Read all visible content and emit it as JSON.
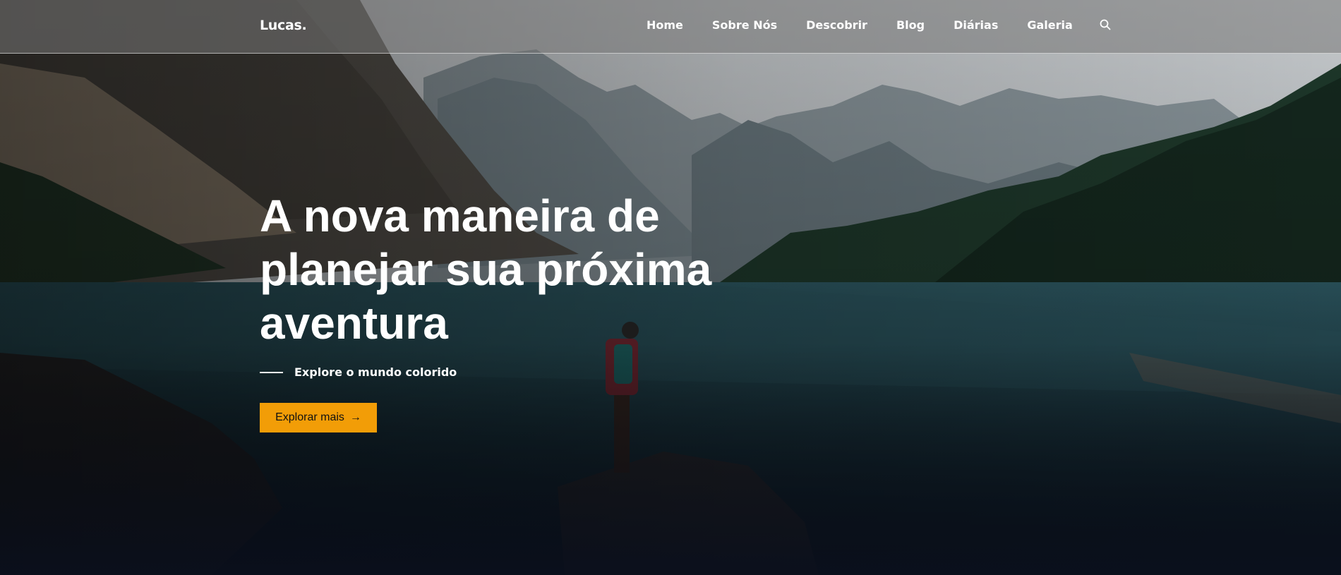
{
  "brand": {
    "name": "Lucas."
  },
  "nav": {
    "links": [
      "Home",
      "Sobre Nós",
      "Descobrir",
      "Blog",
      "Diárias",
      "Galeria"
    ],
    "search_icon": "search-icon"
  },
  "hero": {
    "headline_lines": [
      "A nova maneira de",
      "planejar sua próxima",
      "aventura"
    ],
    "tagline": "Explore o mundo colorido",
    "cta_label": "Explorar mais",
    "cta_icon": "→"
  },
  "colors": {
    "accent": "#f29d07",
    "nav_bg": "#787878",
    "dark_bg": "#0b1220"
  }
}
